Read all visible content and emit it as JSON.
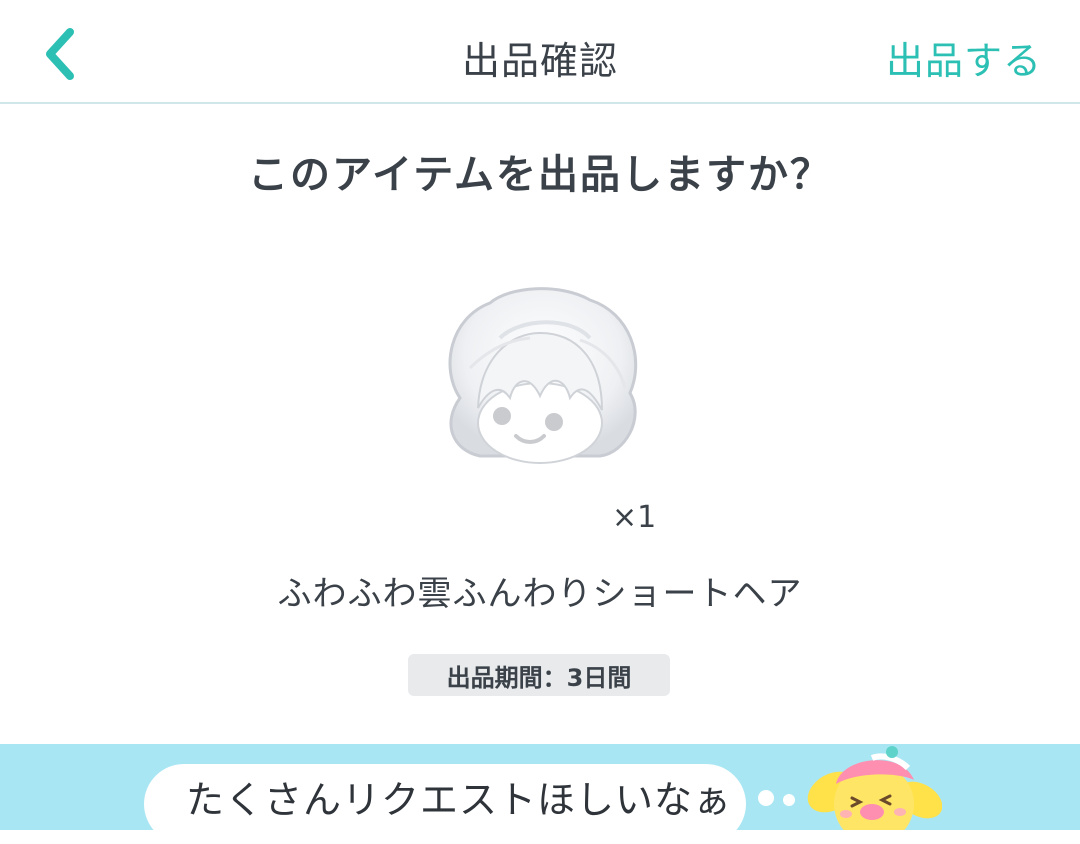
{
  "header": {
    "title": "出品確認",
    "submit_label": "出品する",
    "back_icon": "chevron-left-icon",
    "accent_color": "#2cc0b4"
  },
  "main": {
    "question": "このアイテムを出品しますか？",
    "item": {
      "image_icon": "fluffy-white-hair-avatar",
      "quantity": "×1",
      "name": "ふわふわ雲ふんわりショートヘア"
    },
    "period": "出品期間：3日間"
  },
  "bottom": {
    "speech": "たくさんリクエストほしいなぁ",
    "mascot_icon": "yellow-bird-mascot-icon",
    "bar_color": "#a9e6f3"
  }
}
